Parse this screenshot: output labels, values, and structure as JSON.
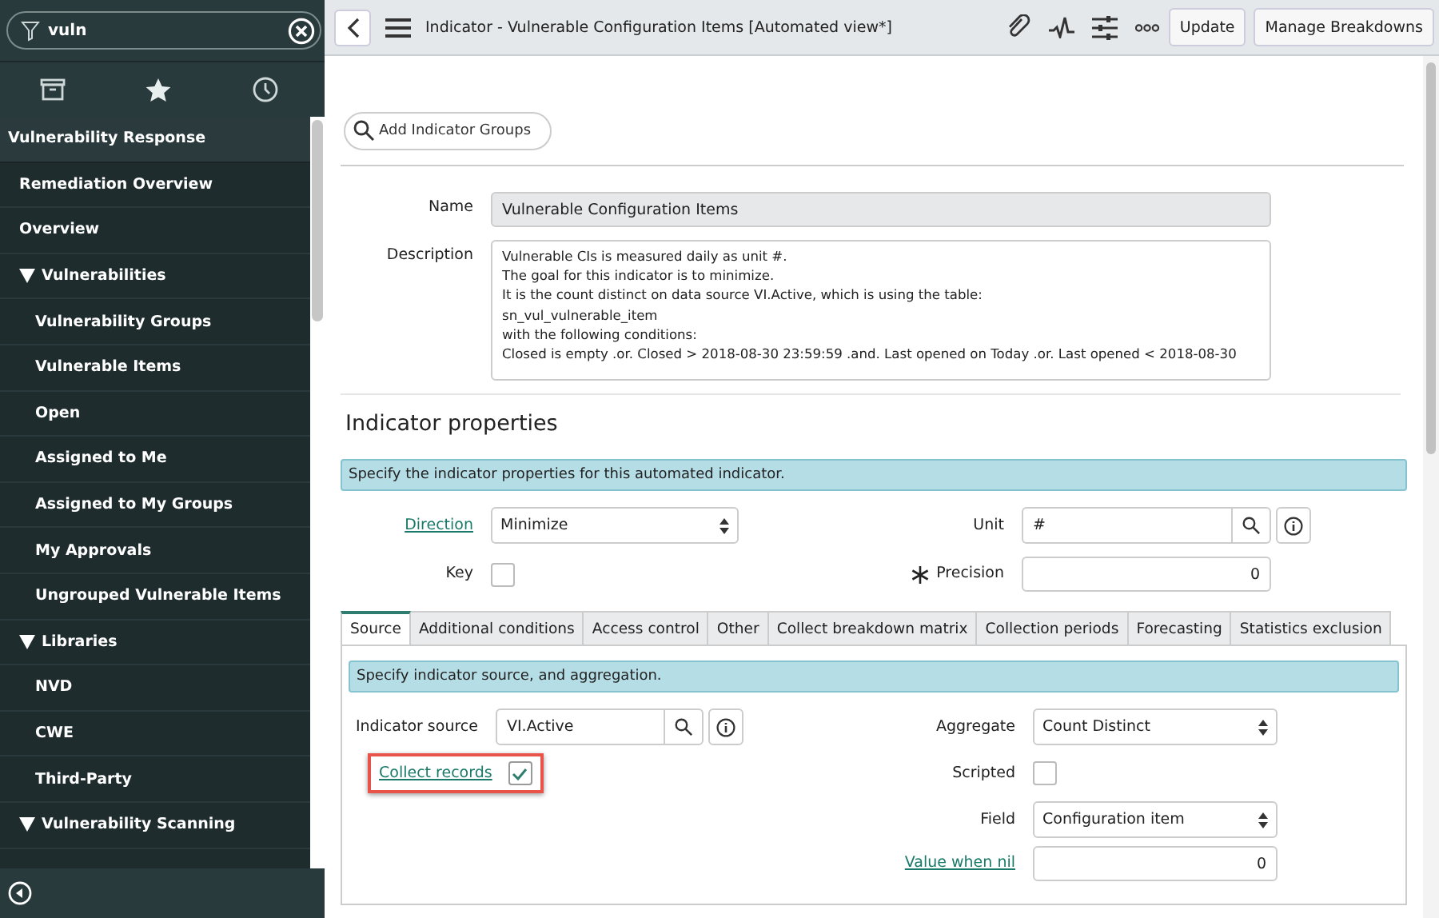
{
  "sidebar": {
    "search": {
      "value": "vuln"
    },
    "section": "Vulnerability Response",
    "items": [
      {
        "label": "Remediation Overview"
      },
      {
        "label": "Overview"
      },
      {
        "label": "Vulnerabilities",
        "expanded": true,
        "children": [
          {
            "label": "Vulnerability Groups"
          },
          {
            "label": "Vulnerable Items"
          },
          {
            "label": "Open"
          },
          {
            "label": "Assigned to Me"
          },
          {
            "label": "Assigned to My Groups"
          },
          {
            "label": "My Approvals"
          },
          {
            "label": "Ungrouped Vulnerable Items"
          }
        ]
      },
      {
        "label": "Libraries",
        "expanded": true,
        "children": [
          {
            "label": "NVD"
          },
          {
            "label": "CWE"
          },
          {
            "label": "Third-Party"
          }
        ]
      },
      {
        "label": "Vulnerability Scanning",
        "expanded": true
      }
    ]
  },
  "header": {
    "title": "Indicator - Vulnerable Configuration Items [Automated view*]",
    "buttons": [
      "Update",
      "Manage Breakdowns"
    ]
  },
  "groups": {
    "placeholder": "Add Indicator Groups"
  },
  "form": {
    "name_label": "Name",
    "name": "Vulnerable Configuration Items",
    "description_label": "Description",
    "description": [
      "Vulnerable CIs is measured daily as unit #.",
      "The goal for this indicator is to minimize.",
      "It is the count distinct on data source VI.Active, which is using the table:",
      "sn_vul_vulnerable_item",
      "with the following conditions:",
      "Closed is empty .or. Closed > 2018-08-30 23:59:59 .and. Last opened on Today .or. Last opened < 2018-08-30"
    ]
  },
  "properties": {
    "heading": "Indicator properties",
    "info": "Specify the indicator properties for this automated indicator.",
    "direction_label": "Direction",
    "direction": "Minimize",
    "unit_label": "Unit",
    "unit": "#",
    "key_label": "Key",
    "key_checked": false,
    "precision_label": "Precision",
    "precision": "0"
  },
  "tabs": [
    {
      "label": "Source",
      "selected": true
    },
    {
      "label": "Additional conditions",
      "selected": false
    },
    {
      "label": "Access control",
      "selected": false
    },
    {
      "label": "Other",
      "selected": false
    },
    {
      "label": "Collect breakdown matrix",
      "selected": false
    },
    {
      "label": "Collection periods",
      "selected": false
    },
    {
      "label": "Forecasting",
      "selected": false
    },
    {
      "label": "Statistics exclusion",
      "selected": false
    }
  ],
  "source": {
    "info": "Specify indicator source, and aggregation.",
    "source_label": "Indicator source",
    "source": "VI.Active",
    "aggregate_label": "Aggregate",
    "aggregate": "Count Distinct",
    "collect_label": "Collect records",
    "collect_checked": true,
    "collect_highlighted": true,
    "scripted_label": "Scripted",
    "scripted_checked": false,
    "field_label": "Field",
    "field": "Configuration item",
    "nil_label": "Value when nil",
    "nil_value": "0"
  }
}
